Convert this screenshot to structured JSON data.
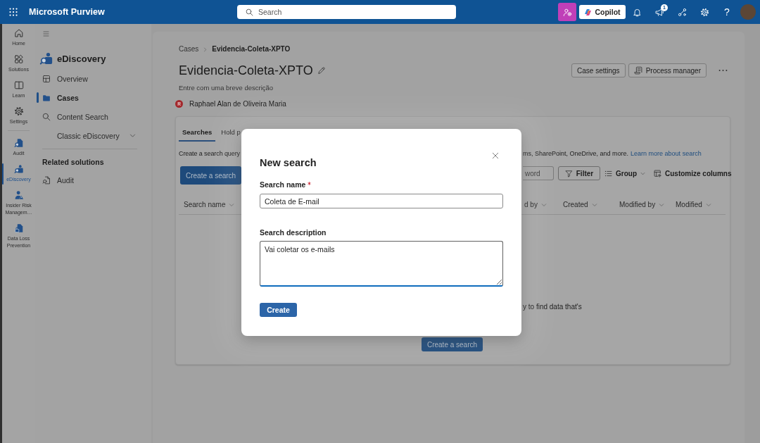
{
  "top_bar": {
    "app_name": "Microsoft Purview",
    "search": {
      "placeholder": "Search"
    },
    "copilot": "Copilot",
    "notification_count": "1",
    "help": "?"
  },
  "rail": {
    "pinned": [
      {
        "label": "Home",
        "kind": "home",
        "selected": false
      },
      {
        "label": "Solutions",
        "kind": "solutions",
        "selected": false
      },
      {
        "label": "Learn",
        "kind": "learn",
        "selected": false
      },
      {
        "label": "Settings",
        "kind": "settings",
        "selected": false
      }
    ],
    "solutions": [
      {
        "label": "Audit",
        "kind": "audit",
        "selected": false
      },
      {
        "label": "eDiscovery",
        "kind": "ediscovery",
        "selected": true
      },
      {
        "label": "Insider Risk Managem…",
        "kind": "insider",
        "selected": false
      },
      {
        "label": "Data Loss Prevention",
        "kind": "dlp",
        "selected": false
      }
    ]
  },
  "sidebar": {
    "title": "eDiscovery",
    "items": [
      {
        "label": "Overview",
        "kind": "overview",
        "selected": false
      },
      {
        "label": "Cases",
        "kind": "cases",
        "selected": true
      },
      {
        "label": "Content Search",
        "kind": "search",
        "selected": false
      },
      {
        "label": "Classic eDiscovery",
        "kind": "group",
        "selected": false,
        "expanded": false
      }
    ],
    "related_title": "Related solutions",
    "related": [
      {
        "label": "Audit",
        "kind": "audit",
        "selected": false
      }
    ]
  },
  "case": {
    "breadcrumb": [
      "Cases",
      "Evidencia-Coleta-XPTO"
    ],
    "title": "Evidencia-Coleta-XPTO",
    "description": "Entre com uma breve descrição",
    "owner": {
      "initial": "R",
      "name": "Raphael Alan de Oliveira Maria"
    },
    "actions": [
      {
        "label": "Case settings",
        "kind": "plain"
      },
      {
        "label": "Process manager",
        "kind": "process"
      }
    ]
  },
  "tabs": [
    {
      "label": "Searches",
      "selected": true
    },
    {
      "label": "Hold p",
      "selected": false
    }
  ],
  "intro": {
    "text": "Create a search query",
    "text_continued": "ms, SharePoint, OneDrive, and more.",
    "link": "Learn more about search"
  },
  "toolbar": {
    "create_button": "Create a search",
    "keyword_field": {
      "placeholder": "word"
    },
    "filter": "Filter",
    "group": "Group",
    "customize": "Customize columns"
  },
  "table": {
    "columns": [
      "Search name",
      "d by",
      "Created",
      "Modified by",
      "Modified"
    ]
  },
  "empty_state": {
    "text": "y to find data that's",
    "button": "Create a search"
  },
  "dialog": {
    "title": "New search",
    "fields": [
      {
        "label": "Search name",
        "required": true,
        "kind": "text",
        "value": "Coleta de E-mail",
        "focused": false
      },
      {
        "label": "Search description",
        "required": false,
        "kind": "multiline",
        "value": "Vai coletar os e-mails",
        "focused": true
      }
    ],
    "submit": "Create"
  }
}
